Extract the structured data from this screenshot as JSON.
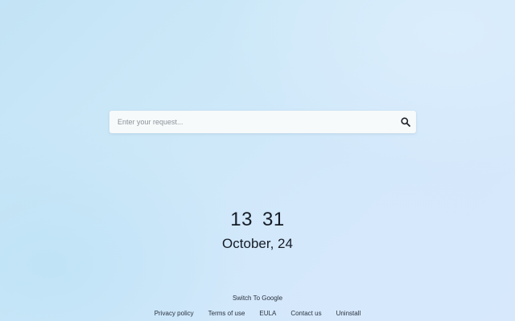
{
  "search": {
    "placeholder": "Enter your request...",
    "value": "",
    "icon": "search-icon"
  },
  "clock": {
    "hours": "13",
    "minutes": "31",
    "date": "October, 24"
  },
  "switch_label": "Switch To Google",
  "footer": {
    "links": [
      "Privacy policy",
      "Terms of use",
      "EULA",
      "Contact us",
      "Uninstall"
    ]
  },
  "colors": {
    "background": "#cce8f8",
    "search_bg": "#f7fafa",
    "text": "#151c26"
  }
}
